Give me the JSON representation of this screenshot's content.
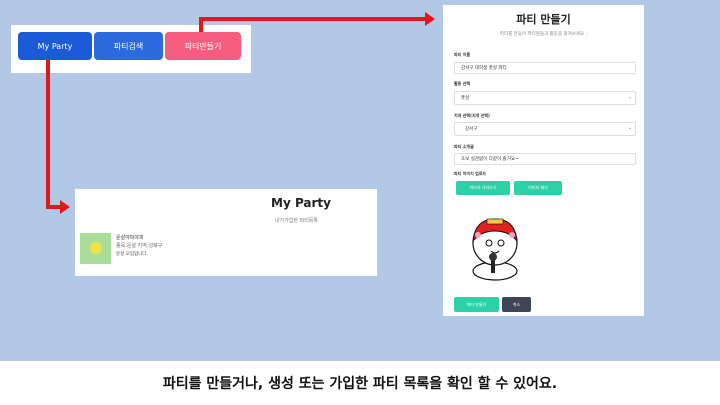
{
  "nav": {
    "my_party": "My Party",
    "search": "파티검색",
    "create": "파티만들기"
  },
  "my_party_page": {
    "title": "My Party",
    "subtitle": "내가가입한 파티목록",
    "item": {
      "name": "운살야피야피",
      "meta": "종목:운살 지역:성북구",
      "desc": "운살 모임입니다."
    }
  },
  "create_page": {
    "title": "파티 만들기",
    "subtitle": "파티를 만들어 파티원들과 활동을 즐겨보세요 :",
    "party_name_label": "파티 이름",
    "party_name_value": "강서구 대학생 풋살 파티",
    "activity_label": "활동 선택",
    "activity_value": "풋살",
    "region_label": "지역 선택(지역 선택)",
    "region_value": "강서구",
    "intro_label": "파티 소개글",
    "intro_value": "초보 실관없이 다같이 즐거요~",
    "image_label": "파티 이미지 업로드",
    "upload_button": "이미지 가져오기",
    "remove_button": "이미지 제거",
    "create_button": "파티 만들기",
    "cancel_button": "취소"
  },
  "caption": "파티를 만들거나, 생성 또는 가입한 파티 목록을 확인 할 수 있어요.",
  "colors": {
    "background": "#b3c7e6",
    "nav_blue": "#1c5bd6",
    "nav_pink": "#f45d80",
    "teal": "#2ed0a7",
    "arrow": "#e3161a"
  }
}
